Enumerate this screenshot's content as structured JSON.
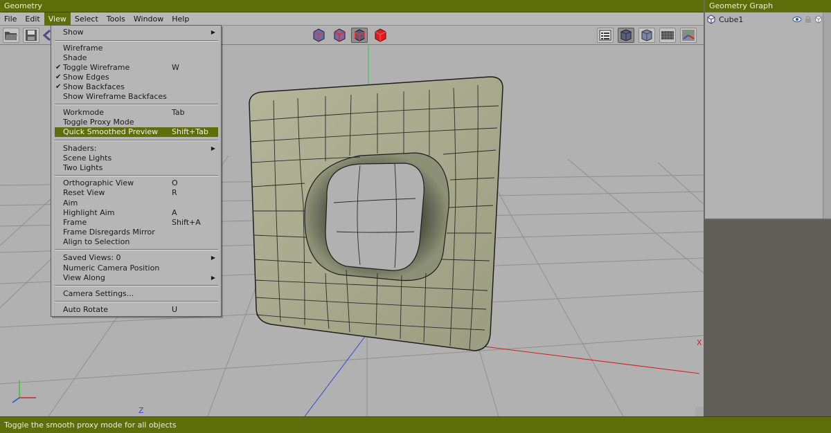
{
  "window": {
    "title": "Geometry"
  },
  "menubar": {
    "items": [
      "File",
      "Edit",
      "View",
      "Select",
      "Tools",
      "Window",
      "Help"
    ],
    "active_index": 2
  },
  "view_menu": {
    "items": [
      {
        "label": "Show",
        "submenu": true
      },
      {
        "label": "Wireframe"
      },
      {
        "label": "Shade"
      },
      {
        "label": "Toggle Wireframe",
        "shortcut": "W",
        "checked": true
      },
      {
        "label": "Show Edges",
        "checked": true
      },
      {
        "label": "Show Backfaces",
        "checked": true
      },
      {
        "label": "Show Wireframe Backfaces"
      },
      {
        "label": "Workmode",
        "shortcut": "Tab"
      },
      {
        "label": "Toggle Proxy Mode"
      },
      {
        "label": "Quick Smoothed Preview",
        "shortcut": "Shift+Tab",
        "highlighted": true
      },
      {
        "label": "Shaders:",
        "submenu": true
      },
      {
        "label": "Scene Lights"
      },
      {
        "label": "Two Lights"
      },
      {
        "label": "Orthographic View",
        "shortcut": "O"
      },
      {
        "label": "Reset View",
        "shortcut": "R"
      },
      {
        "label": "Aim"
      },
      {
        "label": "Highlight Aim",
        "shortcut": "A"
      },
      {
        "label": "Frame",
        "shortcut": "Shift+A"
      },
      {
        "label": "Frame Disregards Mirror"
      },
      {
        "label": "Align to Selection"
      },
      {
        "label": "Saved Views: 0",
        "submenu": true
      },
      {
        "label": "Numeric Camera Position"
      },
      {
        "label": "View Along",
        "submenu": true
      },
      {
        "label": "Camera Settings..."
      },
      {
        "label": "Auto Rotate",
        "shortcut": "U"
      }
    ]
  },
  "toolbar": {
    "left_icons": [
      "open-icon",
      "save-icon",
      "undo-icon"
    ],
    "center_icons": [
      "cube-wire-icon",
      "cube-wire-red-icon",
      "cube-red-wire-pressed-icon",
      "cube-red-solid-icon"
    ],
    "right_icons": [
      "panel-list-icon",
      "shaded-cube-icon",
      "flat-cube-icon",
      "ground-grid-icon",
      "axes-icon"
    ]
  },
  "viewport": {
    "axis_labels": {
      "x": "X",
      "z": "Z"
    },
    "colors": {
      "background": "#b1b1b1",
      "mesh": "#a8ac8c",
      "y_axis": "#2ecc2e",
      "x_axis": "#cc2020",
      "z_axis": "#2a4fd0"
    }
  },
  "geometry_graph": {
    "title": "Geometry Graph",
    "items": [
      {
        "name": "Cube1"
      }
    ]
  },
  "status": {
    "text": "Toggle the smooth proxy mode for all objects"
  },
  "theme": {
    "accent": "#5e6e0a",
    "panel": "#b6b6b6"
  }
}
